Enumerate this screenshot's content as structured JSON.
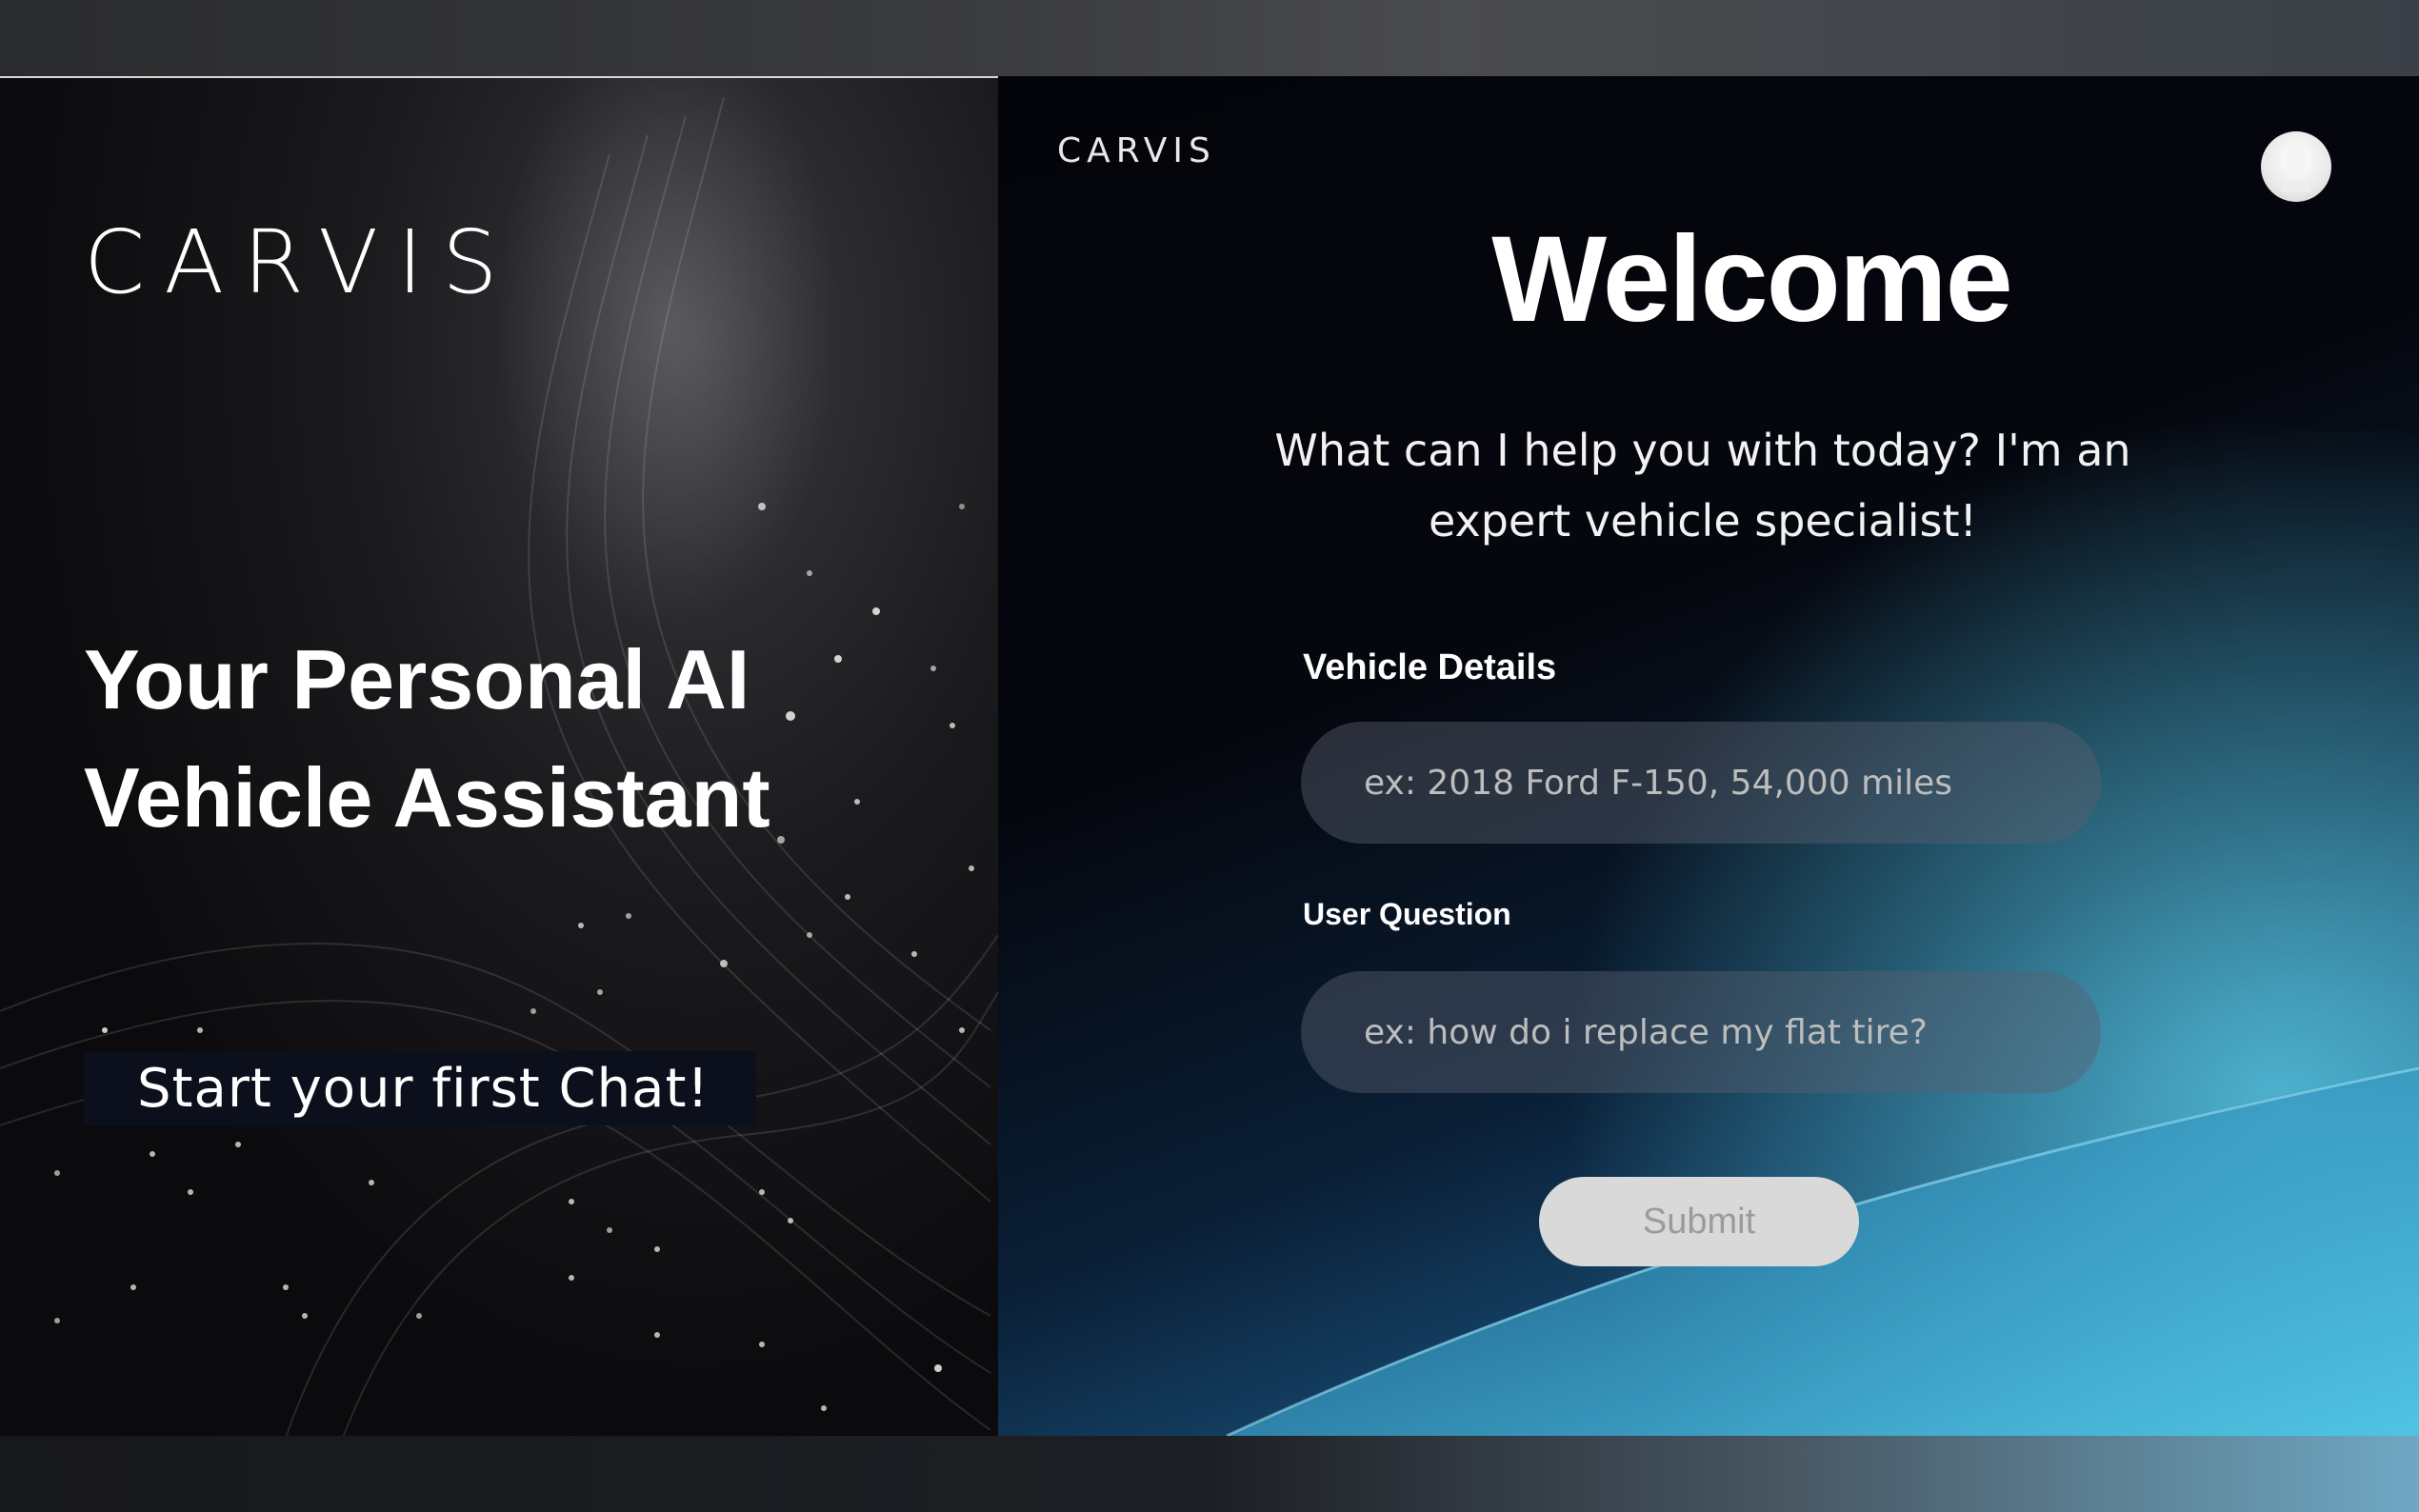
{
  "brand": {
    "name": "CARVIS"
  },
  "left": {
    "headline": "Your Personal AI Vehicle Assistant",
    "cta_label": "Start your first Chat!"
  },
  "right": {
    "brand_name": "CARVIS",
    "avatar_icon": "user-avatar-icon",
    "welcome_title": "Welcome",
    "subtitle": "What can I help you with today? I'm an expert vehicle specialist!",
    "form": {
      "vehicle_label": "Vehicle Details",
      "vehicle_placeholder": "ex: 2018 Ford F-150, 54,000 miles",
      "vehicle_value": "",
      "question_label": "User Question",
      "question_placeholder": "ex: how do i replace my flat tire?",
      "question_value": "",
      "submit_label": "Submit"
    }
  },
  "colors": {
    "left_bg": "#0b0b0d",
    "right_bg_top": "#04050a",
    "right_bg_accent": "#2c7fae",
    "cta_bg": "#0c0f1c",
    "submit_bg": "#d9d9d9"
  }
}
